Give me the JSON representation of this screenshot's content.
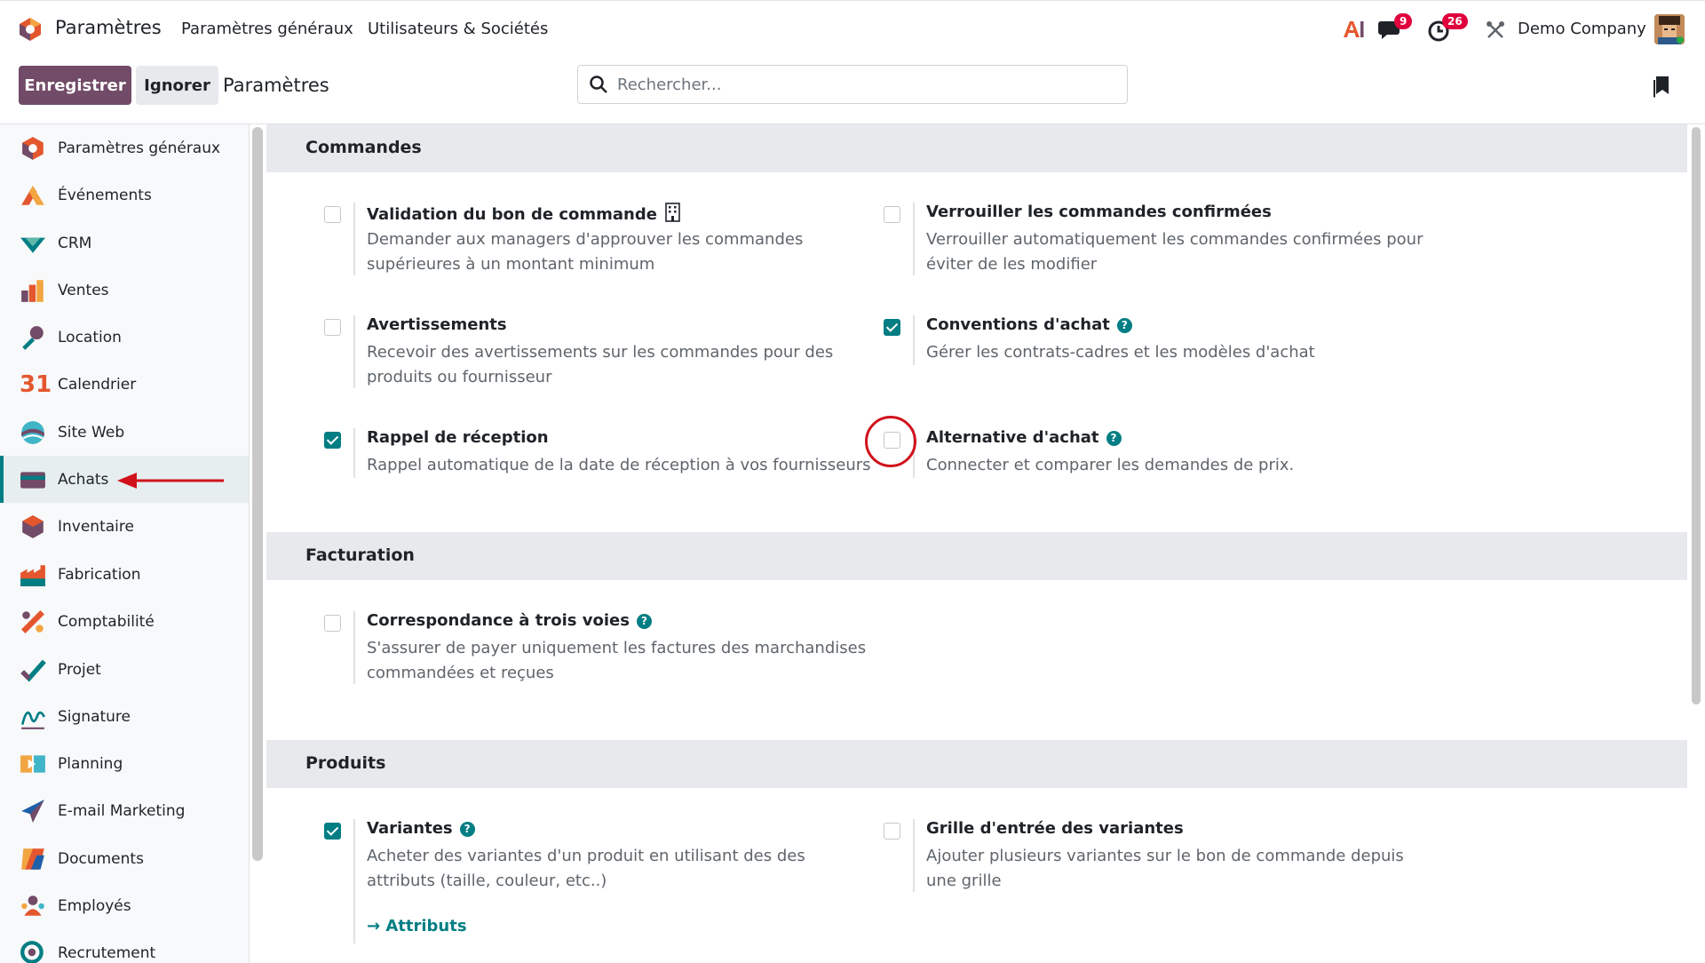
{
  "navbar": {
    "app_name": "Paramètres",
    "menu": [
      "Paramètres généraux",
      "Utilisateurs & Sociétés"
    ],
    "messages_count": "9",
    "activities_count": "26",
    "company": "Demo Company"
  },
  "control_panel": {
    "save_label": "Enregistrer",
    "discard_label": "Ignorer",
    "title": "Paramètres",
    "search_placeholder": "Rechercher..."
  },
  "sidebar": {
    "items": [
      {
        "label": "Paramètres généraux",
        "icon": "settings-app-icon"
      },
      {
        "label": "Événements",
        "icon": "events-app-icon"
      },
      {
        "label": "CRM",
        "icon": "crm-app-icon"
      },
      {
        "label": "Ventes",
        "icon": "sales-app-icon"
      },
      {
        "label": "Location",
        "icon": "rental-app-icon"
      },
      {
        "label": "Calendrier",
        "icon": "calendar-app-icon"
      },
      {
        "label": "Site Web",
        "icon": "website-app-icon"
      },
      {
        "label": "Achats",
        "icon": "purchase-app-icon",
        "active": true
      },
      {
        "label": "Inventaire",
        "icon": "inventory-app-icon"
      },
      {
        "label": "Fabrication",
        "icon": "manufacturing-app-icon"
      },
      {
        "label": "Comptabilité",
        "icon": "accounting-app-icon"
      },
      {
        "label": "Projet",
        "icon": "project-app-icon"
      },
      {
        "label": "Signature",
        "icon": "sign-app-icon"
      },
      {
        "label": "Planning",
        "icon": "planning-app-icon"
      },
      {
        "label": "E-mail Marketing",
        "icon": "email-marketing-app-icon"
      },
      {
        "label": "Documents",
        "icon": "documents-app-icon"
      },
      {
        "label": "Employés",
        "icon": "employees-app-icon"
      },
      {
        "label": "Recrutement",
        "icon": "recruitment-app-icon"
      }
    ]
  },
  "sections": {
    "orders": {
      "title": "Commandes",
      "settings": [
        {
          "title": "Validation du bon de commande",
          "desc": "Demander aux managers d'approuver les commandes supérieures à un montant minimum",
          "checked": false
        },
        {
          "title": "Verrouiller les commandes confirmées",
          "desc": "Verrouiller automatiquement les commandes confirmées pour éviter de les modifier",
          "checked": false
        },
        {
          "title": "Avertissements",
          "desc": "Recevoir des avertissements sur les commandes pour des produits ou fournisseur",
          "checked": false
        },
        {
          "title": "Conventions d'achat",
          "desc": "Gérer les contrats-cadres et les modèles d'achat",
          "checked": true
        },
        {
          "title": "Rappel de réception",
          "desc": "Rappel automatique de la date de réception à vos fournisseurs",
          "checked": true
        },
        {
          "title": "Alternative d'achat",
          "desc": "Connecter et comparer les demandes de prix.",
          "checked": false
        }
      ]
    },
    "billing": {
      "title": "Facturation",
      "settings": [
        {
          "title": "Correspondance à trois voies",
          "desc": "S'assurer de payer uniquement les factures des marchandises commandées et reçues",
          "checked": false
        }
      ]
    },
    "products": {
      "title": "Produits",
      "settings": [
        {
          "title": "Variantes",
          "desc": "Acheter des variantes d'un produit en utilisant des des attributs (taille, couleur, etc..)",
          "checked": true,
          "link": "Attributs"
        },
        {
          "title": "Grille d'entrée des variantes",
          "desc": "Ajouter plusieurs variantes sur le bon de commande depuis une grille",
          "checked": false
        }
      ]
    }
  },
  "colors": {
    "primary": "#714B67",
    "accent": "#017e84",
    "highlight": "#d1121c"
  }
}
